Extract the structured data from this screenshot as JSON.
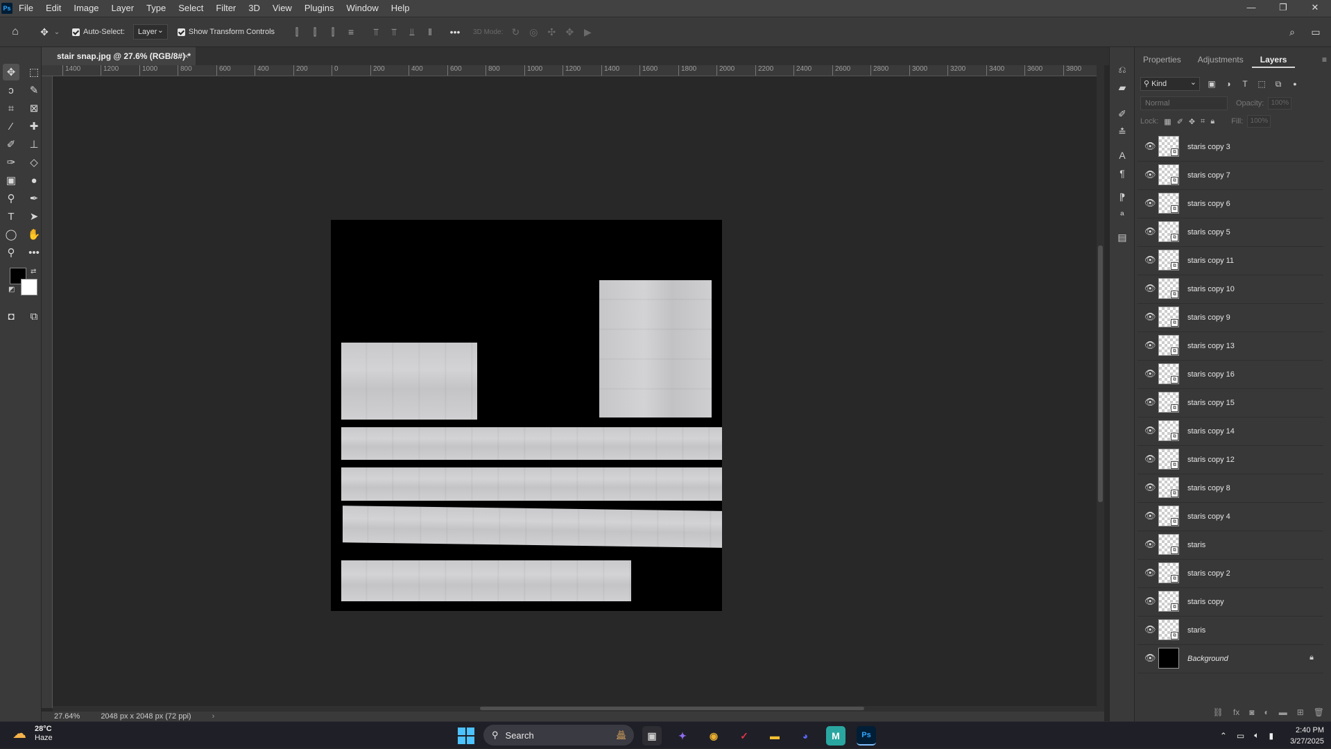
{
  "menubar": {
    "logo": "Ps",
    "items": [
      "File",
      "Edit",
      "Image",
      "Layer",
      "Type",
      "Select",
      "Filter",
      "3D",
      "View",
      "Plugins",
      "Window",
      "Help"
    ],
    "controls": [
      "—",
      "❐",
      "✕"
    ]
  },
  "options": {
    "auto_select_label": "Auto-Select:",
    "auto_select_value": "Layer",
    "transform_label": "Show Transform Controls",
    "mode_label": "3D Mode:"
  },
  "document": {
    "tab_title": "stair snap.jpg @ 27.6% (RGB/8#) *",
    "ruler_ticks": [
      "1400",
      "1200",
      "1000",
      "800",
      "600",
      "400",
      "200",
      "0",
      "200",
      "400",
      "600",
      "800",
      "1000",
      "1200",
      "1400",
      "1600",
      "1800",
      "2000",
      "2200",
      "2400",
      "2600",
      "2800",
      "3000",
      "3200",
      "3400",
      "3600",
      "3800"
    ],
    "zoom": "27.64%",
    "size_info": "2048 px x 2048 px (72 ppi)"
  },
  "panels": {
    "tabs": [
      "Properties",
      "Adjustments",
      "Layers"
    ],
    "active_tab": "Layers",
    "filter_kind": "Kind",
    "blend_mode": "Normal",
    "opacity_label": "Opacity:",
    "opacity_value": "100%",
    "lock_label": "Lock:",
    "fill_label": "Fill:",
    "fill_value": "100%"
  },
  "layers": [
    {
      "name": "staris copy 3"
    },
    {
      "name": "staris copy 7"
    },
    {
      "name": "staris copy 6"
    },
    {
      "name": "staris copy 5"
    },
    {
      "name": "staris copy 11"
    },
    {
      "name": "staris copy 10"
    },
    {
      "name": "staris copy 9"
    },
    {
      "name": "staris copy 13"
    },
    {
      "name": "staris copy 16"
    },
    {
      "name": "staris copy 15"
    },
    {
      "name": "staris copy 14"
    },
    {
      "name": "staris copy 12"
    },
    {
      "name": "staris copy 8"
    },
    {
      "name": "staris copy 4"
    },
    {
      "name": "staris"
    },
    {
      "name": "staris copy 2"
    },
    {
      "name": "staris copy"
    },
    {
      "name": "staris"
    },
    {
      "name": "Background"
    }
  ],
  "taskbar": {
    "temperature": "28°C",
    "condition": "Haze",
    "search_label": "Search",
    "time": "2:40 PM",
    "date": "3/27/2025"
  }
}
